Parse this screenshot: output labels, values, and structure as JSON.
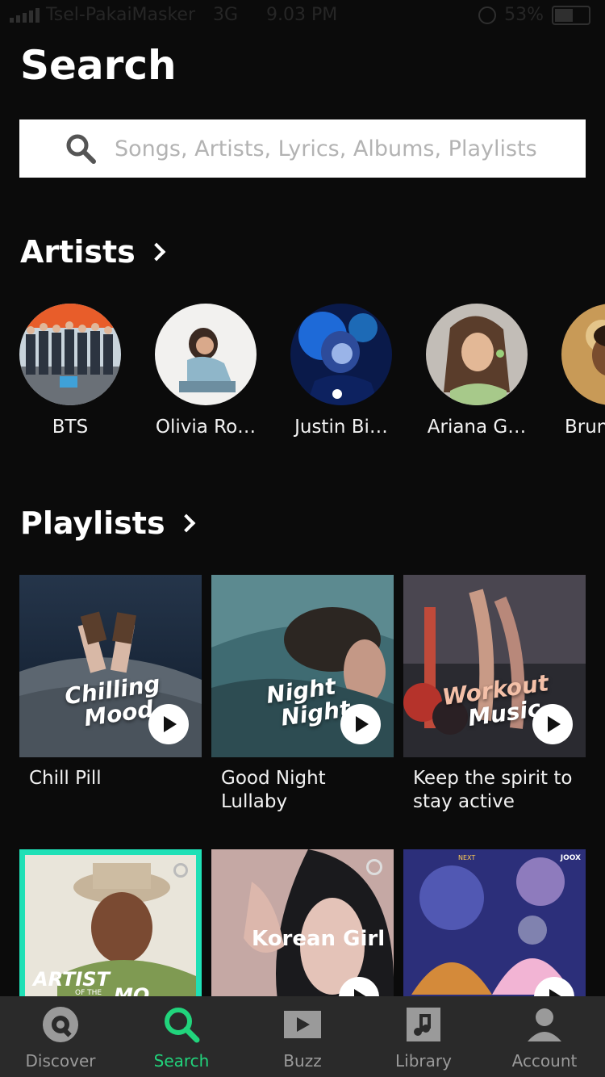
{
  "status_bar": {
    "carrier": "Tsel-PakaiMasker",
    "network": "3G",
    "time": "9.03 PM",
    "battery": "53%"
  },
  "page_title": "Search",
  "search": {
    "placeholder": "Songs, Artists, Lyrics, Albums, Playlists"
  },
  "artists_section": {
    "title": "Artists",
    "items": [
      {
        "name": "BTS"
      },
      {
        "name": "Olivia Ro…"
      },
      {
        "name": "Justin Bi…"
      },
      {
        "name": "Ariana G…"
      },
      {
        "name": "Brun"
      }
    ]
  },
  "playlists_section": {
    "title": "Playlists",
    "items": [
      {
        "cover_text_1": "Chilling",
        "cover_text_2": "Mood",
        "caption": "Chill Pill"
      },
      {
        "cover_text_1": "Night",
        "cover_text_2": "Night",
        "caption": "Good Night Lullaby"
      },
      {
        "cover_text_1": "Workout",
        "cover_text_2": "Music",
        "caption": "Keep the spirit to stay active"
      }
    ],
    "row2": [
      {
        "cover_text": "ARTIST",
        "cover_sub": "OF THE",
        "cover_text_2": "MO"
      },
      {
        "cover_text": "Korean Girl"
      },
      {
        "cover_text": "JOOX",
        "cover_sub": "NEXT"
      }
    ]
  },
  "tab_bar": {
    "tabs": [
      {
        "label": "Discover",
        "icon": "disc-icon"
      },
      {
        "label": "Search",
        "icon": "search-icon"
      },
      {
        "label": "Buzz",
        "icon": "video-icon"
      },
      {
        "label": "Library",
        "icon": "music-note-icon"
      },
      {
        "label": "Account",
        "icon": "person-icon"
      }
    ],
    "active": "Search"
  },
  "colors": {
    "accent": "#21d47c",
    "background": "#0b0b0b",
    "tabbar": "#2a2a2a"
  }
}
